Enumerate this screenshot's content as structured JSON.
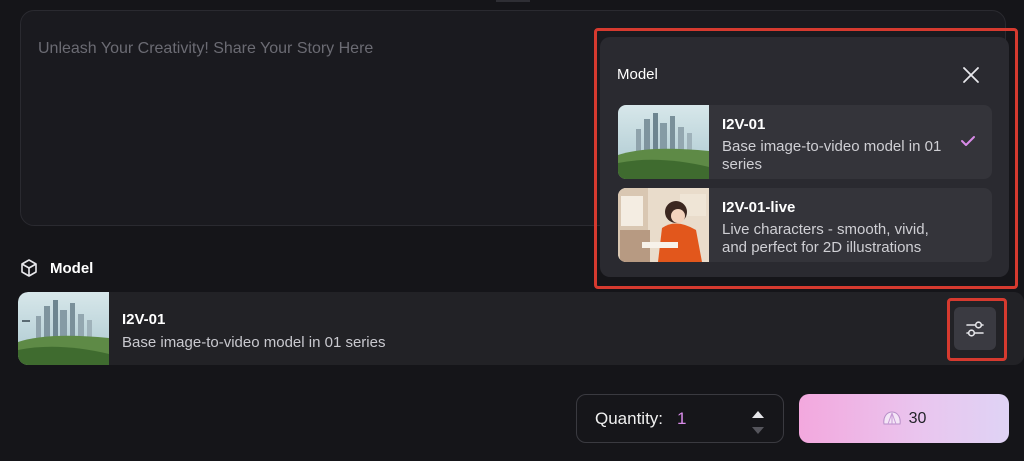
{
  "prompt": {
    "placeholder": "Unleash Your Creativity! Share Your Story Here"
  },
  "model_section": {
    "title": "Model",
    "selected": {
      "name": "I2V-01",
      "description": "Base image-to-video model in 01 series"
    }
  },
  "model_popover": {
    "title": "Model",
    "options": [
      {
        "name": "I2V-01",
        "description": "Base image-to-video model in 01 series",
        "selected": true
      },
      {
        "name": "I2V-01-live",
        "description": "Live characters - smooth, vivid, and perfect for 2D illustrations",
        "selected": false
      }
    ]
  },
  "quantity": {
    "label": "Quantity:",
    "value": "1"
  },
  "generate": {
    "cost": "30"
  },
  "colors": {
    "accent": "#d88be8",
    "highlight_box": "#d63a2f",
    "background": "#151519",
    "card": "#222226",
    "popover": "#2a2a30"
  },
  "icons": [
    "cube-icon",
    "sliders-icon",
    "close-icon",
    "check-icon",
    "chevron-up-icon",
    "chevron-down-icon",
    "shell-icon"
  ]
}
